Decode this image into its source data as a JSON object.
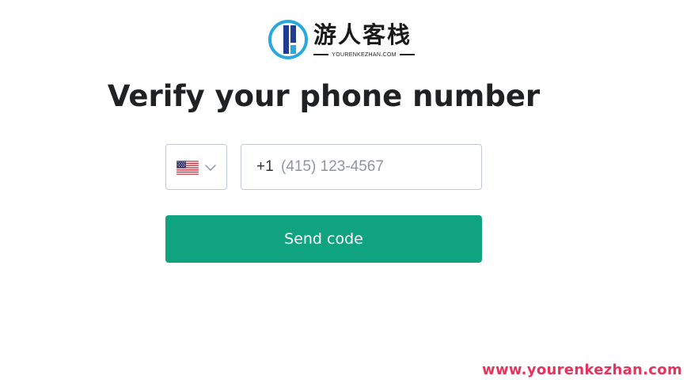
{
  "brand": {
    "name_cn": "游人客栈",
    "name_en": "YOURENKEZHAN.COM",
    "icon": "brand-logo-icon",
    "colors": {
      "ring": "#29a8e0",
      "bar": "#1f3d8f"
    }
  },
  "title": "Verify your phone number",
  "phone_form": {
    "country": {
      "flag_icon": "us-flag-icon",
      "chevron_icon": "chevron-down-icon"
    },
    "dial_code": "+1",
    "value": "",
    "placeholder": "(415) 123-4567"
  },
  "send_button": {
    "label": "Send code",
    "color": "#10a37f"
  },
  "watermark": "www.yourenkezhan.com",
  "colors": {
    "title": "#202123",
    "border": "#c2c8d0",
    "placeholder": "#8e96a0",
    "watermark": "#e6335c"
  }
}
